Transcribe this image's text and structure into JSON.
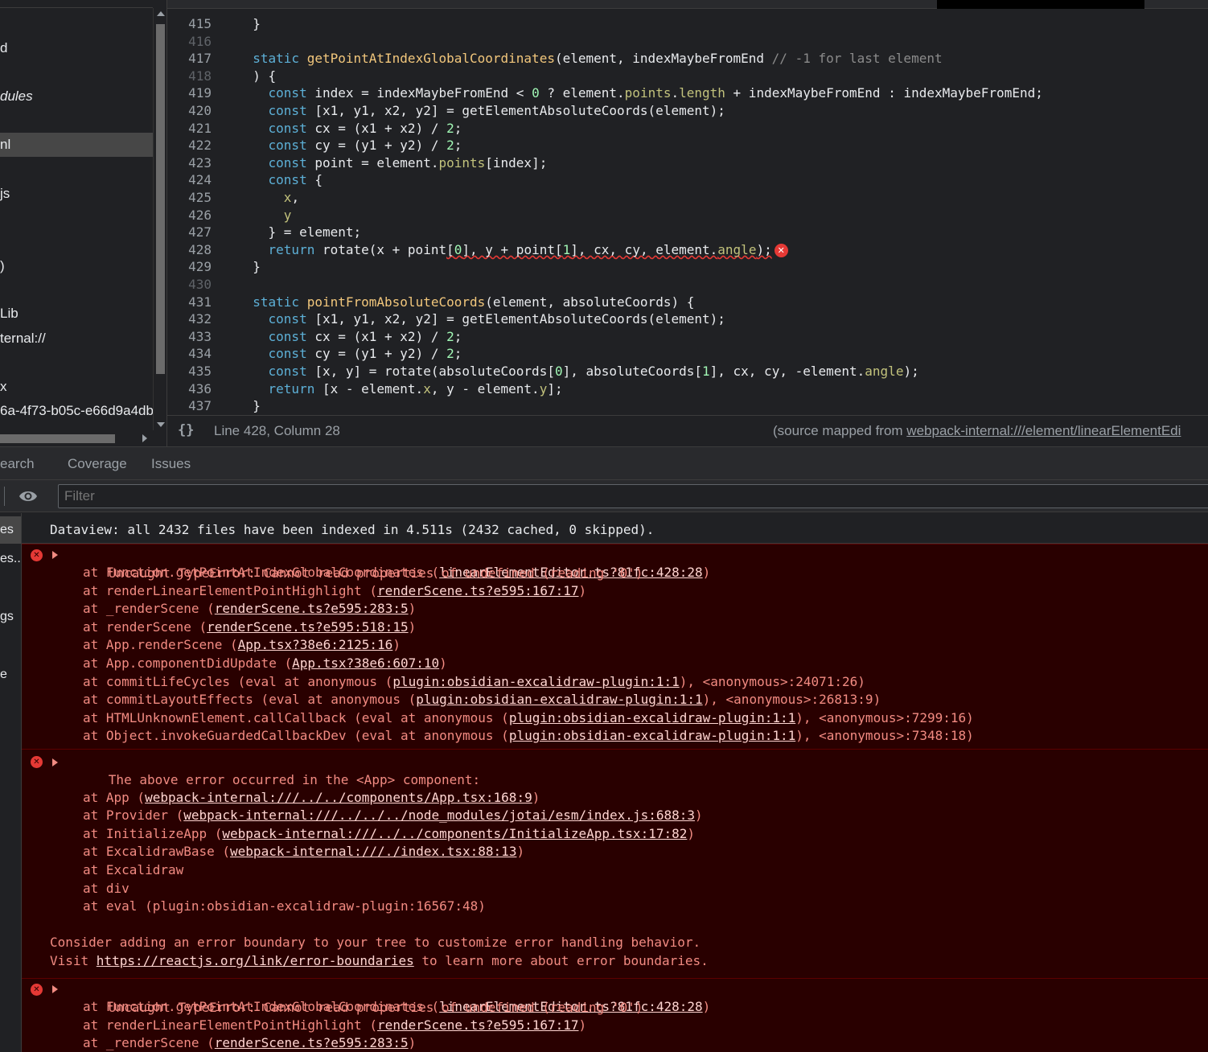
{
  "navigator": {
    "items": [
      {
        "label": "d"
      },
      {
        "label": "dules"
      },
      {
        "label": "nl"
      },
      {
        "label": "js"
      },
      {
        "label": ")"
      },
      {
        "label": "Lib"
      },
      {
        "label": "ternal://"
      },
      {
        "label": "x"
      },
      {
        "label": "6a-4f73-b05c-e66d9a4db"
      }
    ]
  },
  "editor": {
    "lines": [
      {
        "n": "415",
        "segs": [
          {
            "t": "  }"
          }
        ]
      },
      {
        "n": "416",
        "segs": []
      },
      {
        "n": "417",
        "segs": [
          {
            "t": "  "
          },
          {
            "t": "static",
            "c": "kw"
          },
          {
            "t": " "
          },
          {
            "t": "getPointAtIndexGlobalCoordinates",
            "c": "fn"
          },
          {
            "t": "(element, indexMaybeFromEnd "
          },
          {
            "t": "// -1 for last element",
            "c": "cm"
          }
        ]
      },
      {
        "n": "418",
        "segs": [
          {
            "t": "  ) {"
          }
        ]
      },
      {
        "n": "419",
        "segs": [
          {
            "t": "    "
          },
          {
            "t": "const",
            "c": "kw"
          },
          {
            "t": " index = indexMaybeFromEnd < "
          },
          {
            "t": "0",
            "c": "num"
          },
          {
            "t": " ? element."
          },
          {
            "t": "points",
            "c": "prop"
          },
          {
            "t": "."
          },
          {
            "t": "length",
            "c": "prop"
          },
          {
            "t": " + indexMaybeFromEnd : indexMaybeFromEnd;"
          }
        ]
      },
      {
        "n": "420",
        "segs": [
          {
            "t": "    "
          },
          {
            "t": "const",
            "c": "kw"
          },
          {
            "t": " [x1, y1, x2, y2] = getElementAbsoluteCoords(element);"
          }
        ]
      },
      {
        "n": "421",
        "segs": [
          {
            "t": "    "
          },
          {
            "t": "const",
            "c": "kw"
          },
          {
            "t": " cx = (x1 + x2) / "
          },
          {
            "t": "2",
            "c": "num"
          },
          {
            "t": ";"
          }
        ]
      },
      {
        "n": "422",
        "segs": [
          {
            "t": "    "
          },
          {
            "t": "const",
            "c": "kw"
          },
          {
            "t": " cy = (y1 + y2) / "
          },
          {
            "t": "2",
            "c": "num"
          },
          {
            "t": ";"
          }
        ]
      },
      {
        "n": "423",
        "segs": [
          {
            "t": "    "
          },
          {
            "t": "const",
            "c": "kw"
          },
          {
            "t": " point = element."
          },
          {
            "t": "points",
            "c": "prop"
          },
          {
            "t": "[index];"
          }
        ]
      },
      {
        "n": "424",
        "segs": [
          {
            "t": "    "
          },
          {
            "t": "const",
            "c": "kw"
          },
          {
            "t": " {"
          }
        ]
      },
      {
        "n": "425",
        "segs": [
          {
            "t": "      "
          },
          {
            "t": "x",
            "c": "prop"
          },
          {
            "t": ","
          }
        ]
      },
      {
        "n": "426",
        "segs": [
          {
            "t": "      "
          },
          {
            "t": "y",
            "c": "prop"
          }
        ]
      },
      {
        "n": "427",
        "segs": [
          {
            "t": "    } = element;"
          }
        ]
      },
      {
        "n": "428",
        "segs": [
          {
            "t": "    "
          },
          {
            "t": "return",
            "c": "kw"
          },
          {
            "t": " rotate(x + point"
          },
          {
            "t": "[",
            "c": "sq"
          },
          {
            "t": "0",
            "c": "num sq"
          },
          {
            "t": "], y + point[",
            "c": "sq"
          },
          {
            "t": "1",
            "c": "num sq"
          },
          {
            "t": "], cx, cy, element.",
            "c": "sq"
          },
          {
            "t": "angle",
            "c": "prop sq"
          },
          {
            "t": ");",
            "c": "sq"
          }
        ],
        "error": true
      },
      {
        "n": "429",
        "segs": [
          {
            "t": "  }"
          }
        ]
      },
      {
        "n": "430",
        "segs": []
      },
      {
        "n": "431",
        "segs": [
          {
            "t": "  "
          },
          {
            "t": "static",
            "c": "kw"
          },
          {
            "t": " "
          },
          {
            "t": "pointFromAbsoluteCoords",
            "c": "fn"
          },
          {
            "t": "(element, absoluteCoords) {"
          }
        ]
      },
      {
        "n": "432",
        "segs": [
          {
            "t": "    "
          },
          {
            "t": "const",
            "c": "kw"
          },
          {
            "t": " [x1, y1, x2, y2] = getElementAbsoluteCoords(element);"
          }
        ]
      },
      {
        "n": "433",
        "segs": [
          {
            "t": "    "
          },
          {
            "t": "const",
            "c": "kw"
          },
          {
            "t": " cx = (x1 + x2) / "
          },
          {
            "t": "2",
            "c": "num"
          },
          {
            "t": ";"
          }
        ]
      },
      {
        "n": "434",
        "segs": [
          {
            "t": "    "
          },
          {
            "t": "const",
            "c": "kw"
          },
          {
            "t": " cy = (y1 + y2) / "
          },
          {
            "t": "2",
            "c": "num"
          },
          {
            "t": ";"
          }
        ]
      },
      {
        "n": "435",
        "segs": [
          {
            "t": "    "
          },
          {
            "t": "const",
            "c": "kw"
          },
          {
            "t": " [x, y] = rotate(absoluteCoords["
          },
          {
            "t": "0",
            "c": "num"
          },
          {
            "t": "], absoluteCoords["
          },
          {
            "t": "1",
            "c": "num"
          },
          {
            "t": "], cx, cy, -element."
          },
          {
            "t": "angle",
            "c": "prop"
          },
          {
            "t": ");"
          }
        ]
      },
      {
        "n": "436",
        "segs": [
          {
            "t": "    "
          },
          {
            "t": "return",
            "c": "kw"
          },
          {
            "t": " [x - element."
          },
          {
            "t": "x",
            "c": "prop"
          },
          {
            "t": ", y - element."
          },
          {
            "t": "y",
            "c": "prop"
          },
          {
            "t": "];"
          }
        ]
      },
      {
        "n": "437",
        "segs": [
          {
            "t": "  }"
          }
        ]
      }
    ],
    "status": {
      "pretty_print": "{}",
      "position": "Line 428, Column 28",
      "mapped_prefix": "(source mapped from ",
      "mapped_link": "webpack-internal:///element/linearElementEdi"
    }
  },
  "drawer_tabs": [
    {
      "label": "earch"
    },
    {
      "label": "Coverage"
    },
    {
      "label": "Issues"
    }
  ],
  "console_toolbar": {
    "filter_placeholder": "Filter"
  },
  "console_sidebar": {
    "items": [
      {
        "label": "es"
      },
      {
        "label": "es..."
      },
      {
        "label": "gs"
      },
      {
        "label": "e"
      }
    ]
  },
  "console": {
    "info_message": "Dataview: all 2432 files have been indexed in 4.511s (2432 cached, 0 skipped).",
    "error1": {
      "head": "Uncaught TypeError: Cannot read properties of undefined (reading '0')",
      "frames": [
        {
          "pre": "at Function.getPointAtIndexGlobalCoordinates (",
          "link": "linearElementEditor.ts?81fc:428:28",
          "post": ")"
        },
        {
          "pre": "at renderLinearElementPointHighlight (",
          "link": "renderScene.ts?e595:167:17",
          "post": ")"
        },
        {
          "pre": "at _renderScene (",
          "link": "renderScene.ts?e595:283:5",
          "post": ")"
        },
        {
          "pre": "at renderScene (",
          "link": "renderScene.ts?e595:518:15",
          "post": ")"
        },
        {
          "pre": "at App.renderScene (",
          "link": "App.tsx?38e6:2125:16",
          "post": ")"
        },
        {
          "pre": "at App.componentDidUpdate (",
          "link": "App.tsx?38e6:607:10",
          "post": ")"
        },
        {
          "pre": "at commitLifeCycles (eval at anonymous (",
          "link": "plugin:obsidian-excalidraw-plugin:1:1",
          "post": "), <anonymous>:24071:26)"
        },
        {
          "pre": "at commitLayoutEffects (eval at anonymous (",
          "link": "plugin:obsidian-excalidraw-plugin:1:1",
          "post": "), <anonymous>:26813:9)"
        },
        {
          "pre": "at HTMLUnknownElement.callCallback (eval at anonymous (",
          "link": "plugin:obsidian-excalidraw-plugin:1:1",
          "post": "), <anonymous>:7299:16)"
        },
        {
          "pre": "at Object.invokeGuardedCallbackDev (eval at anonymous (",
          "link": "plugin:obsidian-excalidraw-plugin:1:1",
          "post": "), <anonymous>:7348:18)"
        }
      ]
    },
    "error2": {
      "head": "The above error occurred in the <App> component:",
      "frames": [
        {
          "pre": "at App (",
          "link": "webpack-internal:///../../components/App.tsx:168:9",
          "post": ")"
        },
        {
          "pre": "at Provider (",
          "link": "webpack-internal:///../../../node_modules/jotai/esm/index.js:688:3",
          "post": ")"
        },
        {
          "pre": "at InitializeApp (",
          "link": "webpack-internal:///../../components/InitializeApp.tsx:17:82",
          "post": ")"
        },
        {
          "pre": "at ExcalidrawBase (",
          "link": "webpack-internal:///./index.tsx:88:13",
          "post": ")"
        },
        {
          "pre": "at Excalidraw",
          "link": "",
          "post": ""
        },
        {
          "pre": "at div",
          "link": "",
          "post": ""
        },
        {
          "pre": "at eval (plugin:obsidian-excalidraw-plugin:16567:48)",
          "link": "",
          "post": ""
        }
      ],
      "advice1": "Consider adding an error boundary to your tree to customize error handling behavior.",
      "advice2_pre": "Visit ",
      "advice2_link": "https://reactjs.org/link/error-boundaries",
      "advice2_post": " to learn more about error boundaries."
    },
    "error3": {
      "head": "Uncaught TypeError: Cannot read properties of undefined (reading '0')",
      "frames": [
        {
          "pre": "at Function.getPointAtIndexGlobalCoordinates (",
          "link": "linearElementEditor.ts?81fc:428:28",
          "post": ")"
        },
        {
          "pre": "at renderLinearElementPointHighlight (",
          "link": "renderScene.ts?e595:167:17",
          "post": ")"
        },
        {
          "pre": "at _renderScene (",
          "link": "renderScene.ts?e595:283:5",
          "post": ")"
        }
      ]
    }
  }
}
